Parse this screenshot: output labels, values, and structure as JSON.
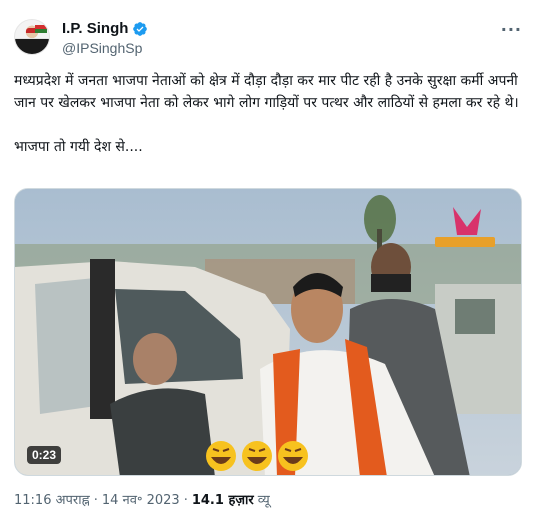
{
  "author": {
    "name": "I.P. Singh",
    "handle": "@IPSinghSp",
    "verified": true
  },
  "icons": {
    "more": "more-options-icon",
    "verified": "verified-badge-icon"
  },
  "tweet": {
    "text_line1": "मध्यप्रदेश में जनता भाजपा नेताओं को क्षेत्र में दौड़ा दौड़ा कर मार पीट रही है उनके सुरक्षा कर्मी अपनी जान पर खेलकर भाजपा नेता को लेकर भागे लोग गाड़ियों पर पत्थर और लाठियों से हमला कर रहे थे।",
    "text_line2": "भाजपा तो गयी देश से...."
  },
  "media": {
    "duration": "0:23",
    "emoji_overlay": "🤣🤣🤣"
  },
  "meta": {
    "time": "11:16 अपराह्न",
    "separator": "·",
    "date": "14 नव॰ 2023",
    "views_count": "14.1 हज़ार",
    "views_label": "व्यू"
  },
  "colors": {
    "accent": "#1d9bf0",
    "secondary_text": "#536471",
    "primary_text": "#0f1419"
  }
}
